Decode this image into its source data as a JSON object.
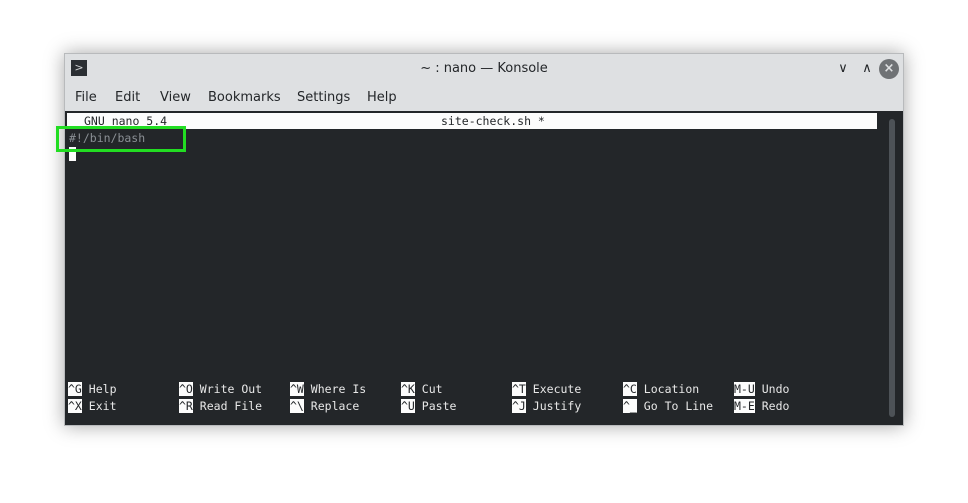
{
  "window": {
    "title": "~ : nano — Konsole",
    "app_icon": "terminal-icon"
  },
  "menu": [
    "File",
    "Edit",
    "View",
    "Bookmarks",
    "Settings",
    "Help"
  ],
  "nano": {
    "version": "GNU nano 5.4",
    "filename": "site-check.sh *",
    "lines": [
      "#!/bin/bash"
    ]
  },
  "shortcuts": [
    [
      {
        "key": "^G",
        "label": "Help"
      },
      {
        "key": "^X",
        "label": "Exit"
      }
    ],
    [
      {
        "key": "^O",
        "label": "Write Out"
      },
      {
        "key": "^R",
        "label": "Read File"
      }
    ],
    [
      {
        "key": "^W",
        "label": "Where Is"
      },
      {
        "key": "^\\",
        "label": "Replace"
      }
    ],
    [
      {
        "key": "^K",
        "label": "Cut"
      },
      {
        "key": "^U",
        "label": "Paste"
      }
    ],
    [
      {
        "key": "^T",
        "label": "Execute"
      },
      {
        "key": "^J",
        "label": "Justify"
      }
    ],
    [
      {
        "key": "^C",
        "label": "Location"
      },
      {
        "key": "^_",
        "label": "Go To Line"
      }
    ],
    [
      {
        "key": "M-U",
        "label": "Undo"
      },
      {
        "key": "M-E",
        "label": "Redo"
      }
    ]
  ],
  "colors": {
    "terminal_bg": "#232629",
    "highlight": "#22dd22",
    "comment": "#8a8f94"
  }
}
